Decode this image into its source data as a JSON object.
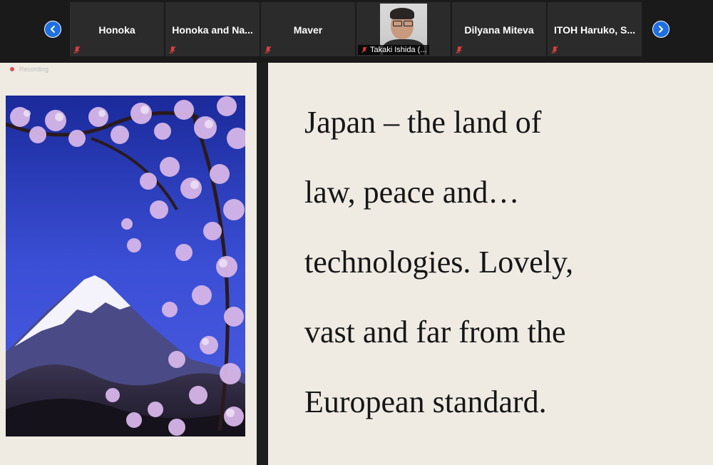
{
  "participants": [
    {
      "name": "Honoka",
      "muted": true
    },
    {
      "name": "Honoka and Na...",
      "muted": true
    },
    {
      "name": "Maver",
      "muted": true
    },
    {
      "name": "Takaki Ishida (...",
      "muted": true,
      "video": true
    },
    {
      "name": "Dilyana Miteva",
      "muted": true
    },
    {
      "name": "ITOH Haruko, S...",
      "muted": true
    }
  ],
  "nav": {
    "prev_icon": "chevron-left-icon",
    "next_icon": "chevron-right-icon"
  },
  "recording": {
    "label": "Recording"
  },
  "slide": {
    "image_subject": "Mount Fuji with cherry blossoms",
    "lines": [
      "Japan – the land of",
      "law, peace and…",
      "technologies. Lovely,",
      "vast and far from the",
      "European standard."
    ]
  },
  "colors": {
    "accent_button": "#1e6fe0",
    "slide_background": "#efebe3",
    "muted_icon": "#e0403a"
  }
}
